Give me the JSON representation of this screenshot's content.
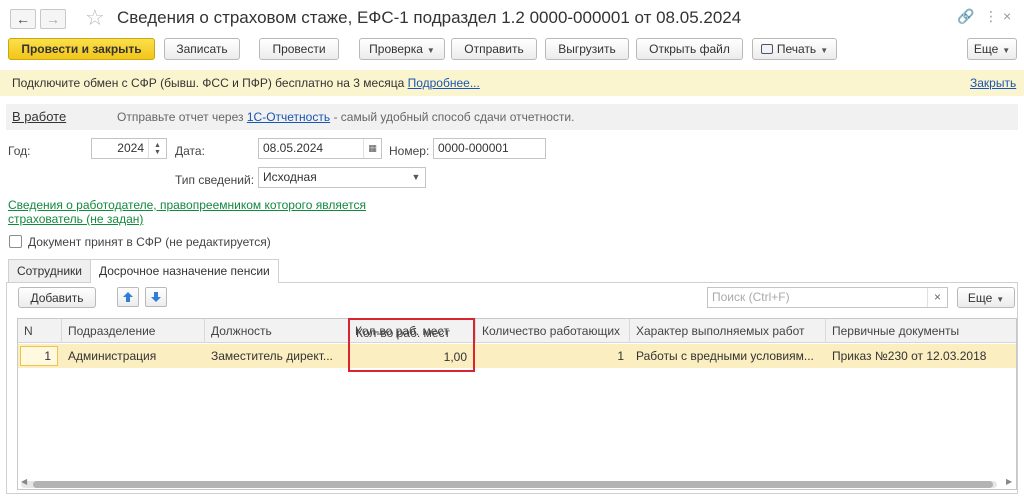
{
  "window": {
    "title": "Сведения о страховом стаже, ЕФС-1 подраздел 1.2 0000-000001 от 08.05.2024"
  },
  "toolbar": {
    "post_close": "Провести и закрыть",
    "save": "Записать",
    "post": "Провести",
    "check": "Проверка",
    "send": "Отправить",
    "upload": "Выгрузить",
    "open_file": "Открыть файл",
    "print": "Печать",
    "more": "Еще"
  },
  "infobar": {
    "text": "Подключите обмен с СФР (бывш. ФСС и ПФР) бесплатно на 3 месяца",
    "more_link": "Подробнее...",
    "close_link": "Закрыть"
  },
  "status": {
    "state_link": "В работе",
    "hint_prefix": "Отправьте отчет через",
    "hint_link": "1С-Отчетность",
    "hint_suffix": "- самый удобный способ сдачи отчетности."
  },
  "form": {
    "year_label": "Год:",
    "year_value": "2024",
    "date_label": "Дата:",
    "date_value": "08.05.2024",
    "number_label": "Номер:",
    "number_value": "0000-000001",
    "type_label": "Тип сведений:",
    "type_value": "Исходная",
    "employer_link_line1": "Сведения о работодателе, правопреемником которого является",
    "employer_link_line2": "страхователь (не задан)",
    "accepted_checkbox_label": "Документ принят в СФР (не редактируется)",
    "accepted_checked": false
  },
  "tabs": [
    {
      "label": "Сотрудники",
      "active": false
    },
    {
      "label": "Досрочное назначение пенсии",
      "active": true
    }
  ],
  "table_toolbar": {
    "add": "Добавить",
    "search_placeholder": "Поиск (Ctrl+F)",
    "clear": "×",
    "more": "Еще"
  },
  "table": {
    "columns": [
      "N",
      "Подразделение",
      "Должность",
      "Кол-во раб. мест",
      "Количество работающих",
      "Характер выполняемых работ",
      "Первичные документы"
    ],
    "rows": [
      {
        "n": "1",
        "department": "Администрация",
        "position": "Заместитель директ...",
        "workplaces": "1,00",
        "workers": "1",
        "work_nature": "Работы с вредными условиям...",
        "documents": "Приказ №230 от 12.03.2018"
      }
    ]
  },
  "colors": {
    "primary_button": "#f2c51a",
    "selected_row": "#fbeec0",
    "infobar": "#fbf5cf",
    "highlight_border": "#d9232e",
    "link": "#1a55b2",
    "link_green": "#13893e"
  }
}
